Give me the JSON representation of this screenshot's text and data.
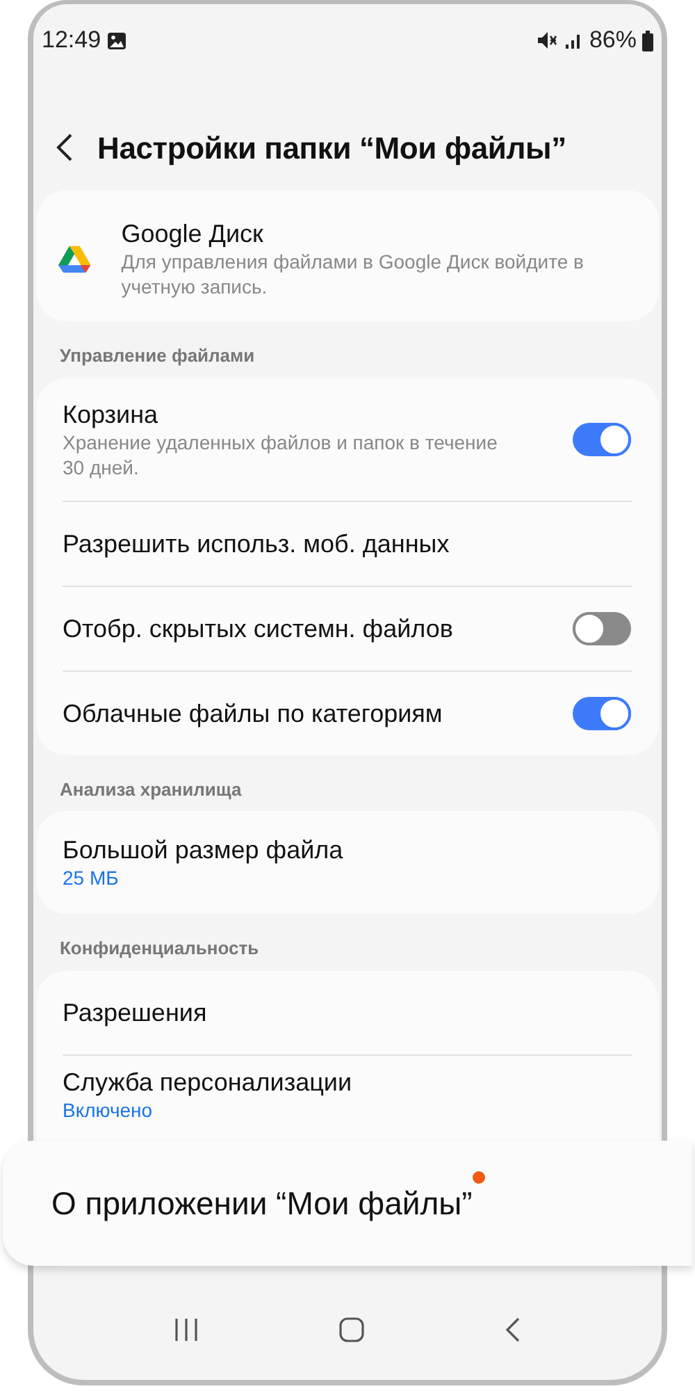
{
  "status_bar": {
    "time": "12:49",
    "battery": "86%"
  },
  "header": {
    "title": "Настройки папки “Мои файлы”"
  },
  "account": {
    "title": "Google Диск",
    "subtitle": "Для управления файлами в Google Диск войдите в учетную запись."
  },
  "sections": [
    {
      "heading": "Управление файлами",
      "items": [
        {
          "kind": "switch",
          "title": "Корзина",
          "subtitle": "Хранение удаленных файлов и папок в течение 30 дней.",
          "on": true
        },
        {
          "kind": "link",
          "title": "Разрешить использ. моб. данных"
        },
        {
          "kind": "switch",
          "title": "Отобр. скрытых системн. файлов",
          "on": false
        },
        {
          "kind": "switch",
          "title": "Облачные файлы по категориям",
          "on": true
        }
      ]
    },
    {
      "heading": "Анализа хранилища",
      "items": [
        {
          "kind": "link",
          "title": "Большой размер файла",
          "value": "25 МБ"
        }
      ]
    },
    {
      "heading": "Конфиденциальность",
      "items": [
        {
          "kind": "link",
          "title": "Разрешения"
        },
        {
          "kind": "link",
          "title": "Служба персонализации",
          "value": "Включено"
        }
      ]
    }
  ],
  "callout": {
    "title": "О приложении “Мои файлы”",
    "new_badge": true
  }
}
